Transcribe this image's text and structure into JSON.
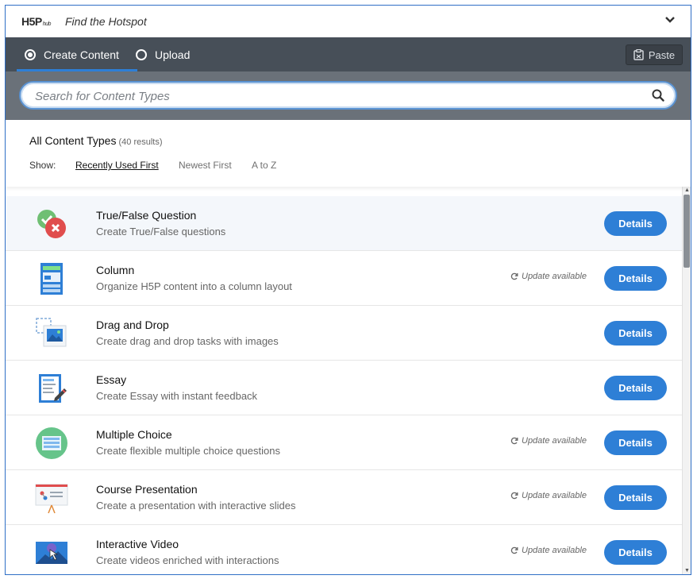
{
  "header": {
    "logo_main": "H5P",
    "logo_sub": "hub",
    "title": "Find the Hotspot"
  },
  "tabs": {
    "create_label": "Create Content",
    "upload_label": "Upload",
    "paste_label": "Paste"
  },
  "search": {
    "placeholder": "Search for Content Types",
    "value": ""
  },
  "results": {
    "heading": "All Content Types",
    "count_text": "(40 results)",
    "show_label": "Show:",
    "sort_options": [
      "Recently Used First",
      "Newest First",
      "A to Z"
    ],
    "active_sort": "Recently Used First"
  },
  "items": [
    {
      "title": "True/False Question",
      "desc": "Create True/False questions",
      "update": "",
      "button": "Details",
      "icon": "true-false-icon"
    },
    {
      "title": "Column",
      "desc": "Organize H5P content into a column layout",
      "update": "Update available",
      "button": "Details",
      "icon": "column-icon"
    },
    {
      "title": "Drag and Drop",
      "desc": "Create drag and drop tasks with images",
      "update": "",
      "button": "Details",
      "icon": "drag-drop-icon"
    },
    {
      "title": "Essay",
      "desc": "Create Essay with instant feedback",
      "update": "",
      "button": "Details",
      "icon": "essay-icon"
    },
    {
      "title": "Multiple Choice",
      "desc": "Create flexible multiple choice questions",
      "update": "Update available",
      "button": "Details",
      "icon": "multiple-choice-icon"
    },
    {
      "title": "Course Presentation",
      "desc": "Create a presentation with interactive slides",
      "update": "Update available",
      "button": "Details",
      "icon": "presentation-icon"
    },
    {
      "title": "Interactive Video",
      "desc": "Create videos enriched with interactions",
      "update": "Update available",
      "button": "Details",
      "icon": "video-icon"
    }
  ],
  "colors": {
    "accent": "#2e7fd6",
    "tabbar": "#474f58",
    "searchbar": "#6a7179"
  }
}
